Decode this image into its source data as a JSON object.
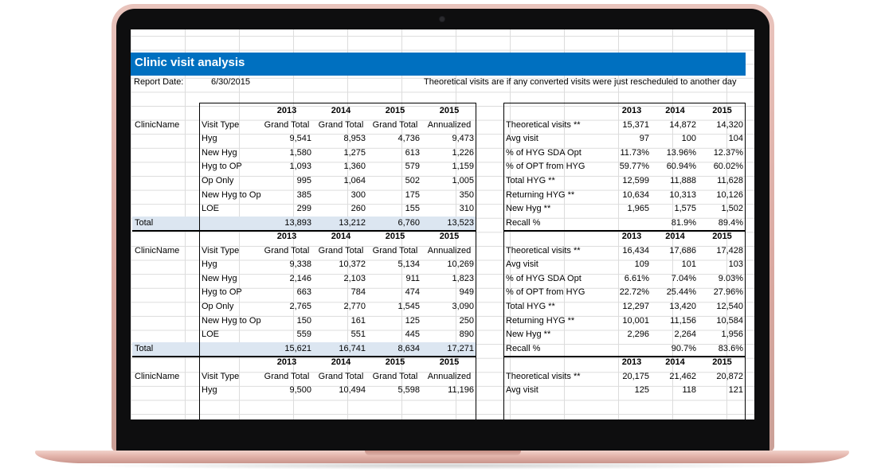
{
  "sheet": {
    "title": "Clinic visit analysis",
    "report_date_label": "Report Date:",
    "report_date_value": "6/30/2015",
    "note": "Theoretical visits are if any converted visits were just rescheduled to another day"
  },
  "left_header": {
    "years": [
      "2013",
      "2014",
      "2015",
      "2015"
    ],
    "clinic_col": "ClinicName",
    "visit_col": "Visit Type",
    "cols": [
      "Grand Total",
      "Grand Total",
      "Grand Total",
      "Annualized"
    ]
  },
  "right_header": {
    "years": [
      "2013",
      "2014",
      "2015"
    ]
  },
  "sections": [
    {
      "rows": [
        {
          "type": "Hyg",
          "vals": [
            "9,541",
            "8,953",
            "4,736",
            "9,473"
          ]
        },
        {
          "type": "New Hyg",
          "vals": [
            "1,580",
            "1,275",
            "613",
            "1,226"
          ]
        },
        {
          "type": "Hyg to OP",
          "vals": [
            "1,093",
            "1,360",
            "579",
            "1,159"
          ]
        },
        {
          "type": "Op Only",
          "vals": [
            "995",
            "1,064",
            "502",
            "1,005"
          ]
        },
        {
          "type": "New Hyg to Op",
          "vals": [
            "385",
            "300",
            "175",
            "350"
          ]
        },
        {
          "type": "LOE",
          "vals": [
            "299",
            "260",
            "155",
            "310"
          ]
        }
      ],
      "total_label": "Total",
      "total_vals": [
        "13,893",
        "13,212",
        "6,760",
        "13,523"
      ],
      "metrics": [
        {
          "label": "Theoretical visits **",
          "vals": [
            "15,371",
            "14,872",
            "14,320"
          ]
        },
        {
          "label": "Avg visit",
          "vals": [
            "97",
            "100",
            "104"
          ]
        },
        {
          "label": "% of HYG SDA Opt",
          "vals": [
            "11.73%",
            "13.96%",
            "12.37%"
          ]
        },
        {
          "label": "% of OPT from HYG",
          "vals": [
            "59.77%",
            "60.94%",
            "60.02%"
          ]
        },
        {
          "label": "Total HYG **",
          "vals": [
            "12,599",
            "11,888",
            "11,628"
          ]
        },
        {
          "label": "Returning HYG **",
          "vals": [
            "10,634",
            "10,313",
            "10,126"
          ]
        },
        {
          "label": "New Hyg **",
          "vals": [
            "1,965",
            "1,575",
            "1,502"
          ]
        },
        {
          "label": "Recall %",
          "vals": [
            "",
            "81.9%",
            "89.4%"
          ]
        }
      ]
    },
    {
      "rows": [
        {
          "type": "Hyg",
          "vals": [
            "9,338",
            "10,372",
            "5,134",
            "10,269"
          ]
        },
        {
          "type": "New Hyg",
          "vals": [
            "2,146",
            "2,103",
            "911",
            "1,823"
          ]
        },
        {
          "type": "Hyg to OP",
          "vals": [
            "663",
            "784",
            "474",
            "949"
          ]
        },
        {
          "type": "Op Only",
          "vals": [
            "2,765",
            "2,770",
            "1,545",
            "3,090"
          ]
        },
        {
          "type": "New Hyg to Op",
          "vals": [
            "150",
            "161",
            "125",
            "250"
          ]
        },
        {
          "type": "LOE",
          "vals": [
            "559",
            "551",
            "445",
            "890"
          ]
        }
      ],
      "total_label": "Total",
      "total_vals": [
        "15,621",
        "16,741",
        "8,634",
        "17,271"
      ],
      "metrics": [
        {
          "label": "Theoretical visits **",
          "vals": [
            "16,434",
            "17,686",
            "17,428"
          ]
        },
        {
          "label": "Avg visit",
          "vals": [
            "109",
            "101",
            "103"
          ]
        },
        {
          "label": "% of HYG SDA Opt",
          "vals": [
            "6.61%",
            "7.04%",
            "9.03%"
          ]
        },
        {
          "label": "% of OPT from HYG",
          "vals": [
            "22.72%",
            "25.44%",
            "27.96%"
          ]
        },
        {
          "label": "Total HYG **",
          "vals": [
            "12,297",
            "13,420",
            "12,540"
          ]
        },
        {
          "label": "Returning HYG **",
          "vals": [
            "10,001",
            "11,156",
            "10,584"
          ]
        },
        {
          "label": "New Hyg **",
          "vals": [
            "2,296",
            "2,264",
            "1,956"
          ]
        },
        {
          "label": "Recall %",
          "vals": [
            "",
            "90.7%",
            "83.6%"
          ]
        }
      ]
    },
    {
      "rows": [
        {
          "type": "Hyg",
          "vals": [
            "9,500",
            "10,494",
            "5,598",
            "11,196"
          ]
        }
      ],
      "metrics": [
        {
          "label": "Theoretical visits **",
          "vals": [
            "20,175",
            "21,462",
            "20,872"
          ]
        },
        {
          "label": "Avg visit",
          "vals": [
            "125",
            "118",
            "121"
          ]
        }
      ]
    }
  ]
}
